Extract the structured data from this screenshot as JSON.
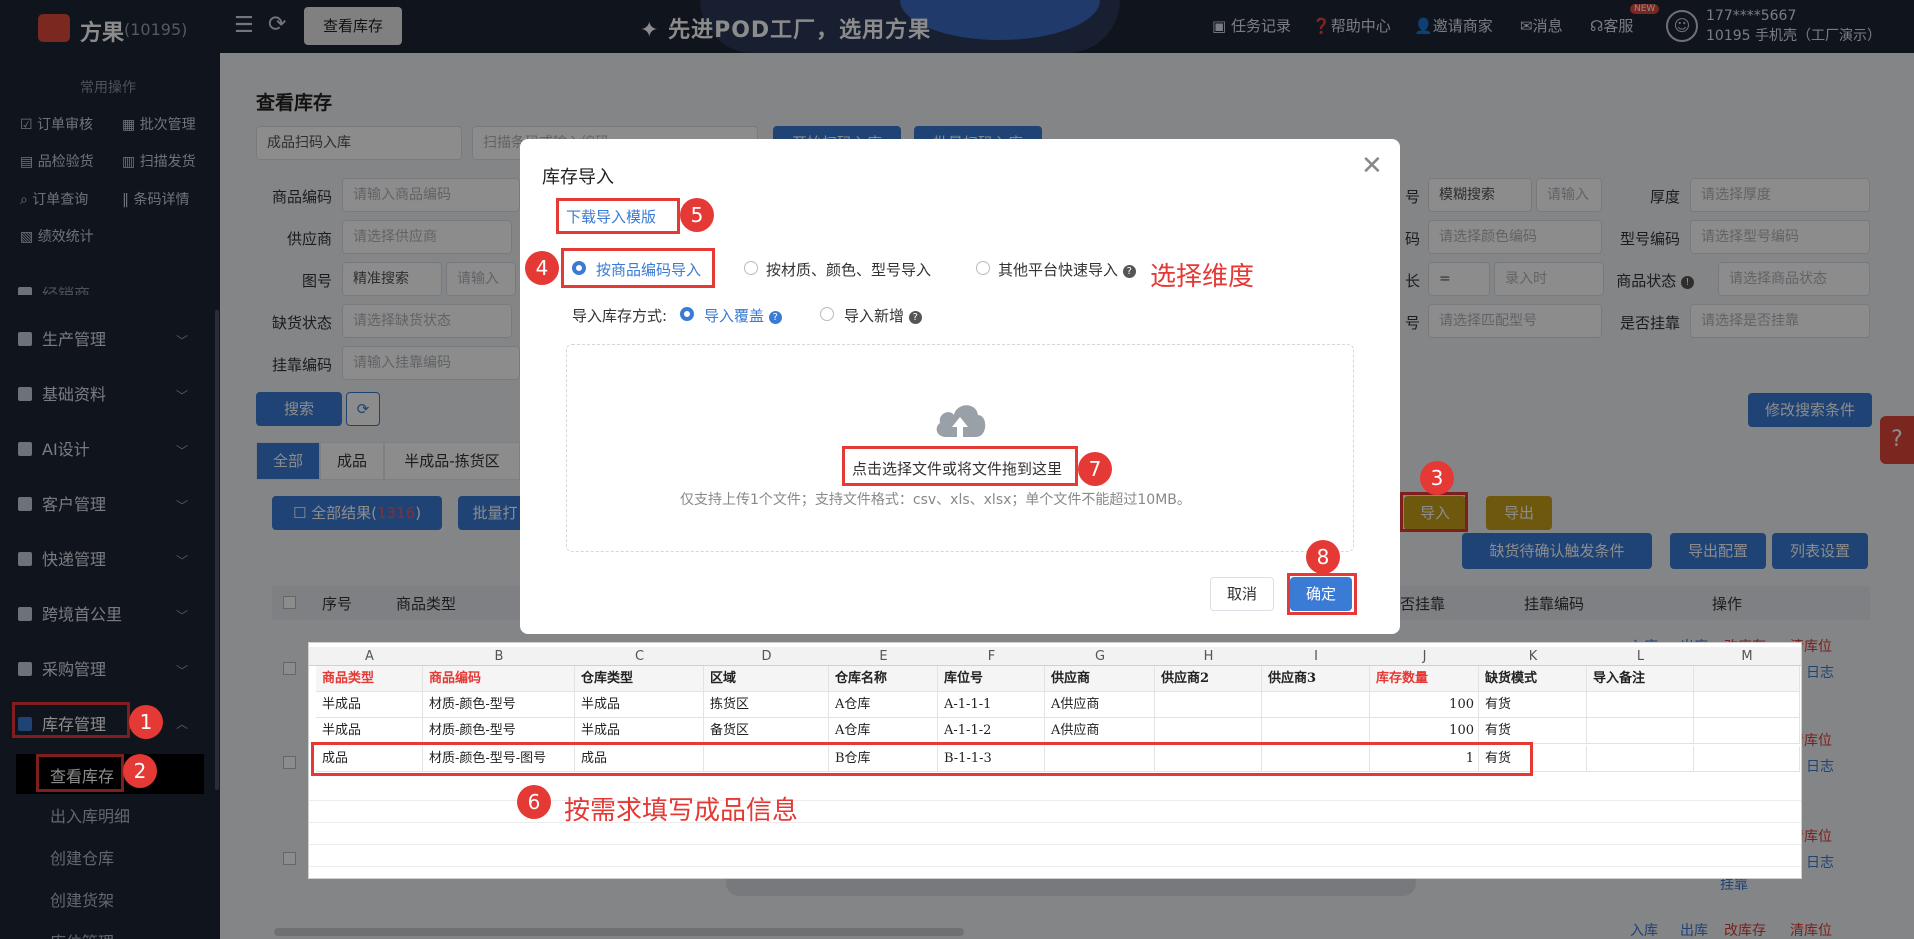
{
  "header": {
    "logo_name": "方果",
    "logo_id": "(10195)",
    "menu_icon": "hamburger-icon",
    "refresh_icon": "refresh-icon",
    "active_tab": "查看库存",
    "slogan": "✦ 先进POD工厂，选用方果",
    "links": [
      "任务记录",
      "帮助中心",
      "邀请商家",
      "消息",
      "客服"
    ],
    "new_badge": "NEW",
    "user_phone": "177****5667",
    "user_company": "10195 手机壳（工厂演示）"
  },
  "sidebar": {
    "common_title": "常用操作",
    "quick": [
      "订单审核",
      "批次管理",
      "品检验货",
      "扫描发货",
      "订单查询",
      "条码详情",
      "绩效统计"
    ],
    "partial_item": "经销商",
    "menus": [
      "生产管理",
      "基础资料",
      "AI设计",
      "客户管理",
      "快递管理",
      "跨境首公里",
      "采购管理",
      "库存管理"
    ],
    "sub_items": [
      "查看库存",
      "出入库明细",
      "创建仓库",
      "创建货架",
      "库位管理"
    ]
  },
  "page": {
    "title": "查看库存",
    "scan_select": "成品扫码入库",
    "scan_input": "扫描条码或输入编码",
    "btn_top1": "开始扫码入库",
    "btn_top2": "批量扫码入库",
    "filters": {
      "product_code_label": "商品编码",
      "product_code_ph": "请输入商品编码",
      "supplier_label": "供应商",
      "supplier_ph": "请选择供应商",
      "figure_label": "图号",
      "figure_mode": "精准搜索",
      "figure_ph": "请输入",
      "shortage_label": "缺货状态",
      "shortage_ph": "请选择缺货状态",
      "hang_code_label": "挂靠编码",
      "hang_code_ph": "请输入挂靠编码",
      "model_no_label": "号",
      "fuzzy": "模糊搜索",
      "fuzzy_ph": "请输入",
      "thickness_label": "厚度",
      "thickness_ph": "请选择厚度",
      "color_code_label": "码",
      "color_code_ph": "请选择颜色编码",
      "model_code_label": "型号编码",
      "model_code_ph": "请选择型号编码",
      "length_label": "长",
      "eq": "=",
      "len_ph": "录入时",
      "status_label": "商品状态",
      "status_ph": "请选择商品状态",
      "match_label": "号",
      "match_ph": "请选择匹配型号",
      "hang_label": "是否挂靠",
      "hang_ph": "请选择是否挂靠"
    },
    "search_btn": "搜索",
    "modify_search": "修改搜索条件",
    "tabs": [
      "全部",
      "成品",
      "半成品-拣货区",
      "半"
    ],
    "all_results": "全部结果(",
    "all_results_count": "1316",
    "all_results_end": ")",
    "batch_btn": "批量打",
    "import_btn": "导入",
    "export_btn": "导出",
    "shortage_trigger": "缺货待确认触发条件",
    "export_config": "导出配置",
    "list_settings": "列表设置",
    "table_headers": [
      "序号",
      "商品类型",
      "否挂靠",
      "挂靠编码",
      "操作"
    ],
    "row_actions": [
      "入库",
      "出库",
      "改库存",
      "清库位",
      "日志"
    ],
    "extra_link": "挂靠",
    "help_icon": "question-icon"
  },
  "modal": {
    "title": "库存导入",
    "download": "下载导入模版",
    "dims": [
      "按商品编码导入",
      "按材质、颜色、型号导入",
      "其他平台快速导入"
    ],
    "dim_note": "选择维度",
    "import_mode_label": "导入库存方式:",
    "modes": [
      "导入覆盖",
      "导入新增"
    ],
    "upload_text": "点击选择文件或将文件拖到这里",
    "upload_hint": "仅支持上传1个文件；支持文件格式：csv、xls、xlsx；单个文件不能超过10MB。",
    "cancel": "取消",
    "ok": "确定"
  },
  "badges": [
    "1",
    "2",
    "3",
    "4",
    "5",
    "6",
    "7",
    "8"
  ],
  "excel": {
    "columns": [
      "A",
      "B",
      "C",
      "D",
      "E",
      "F",
      "G",
      "H",
      "I",
      "J",
      "K",
      "L",
      "M"
    ],
    "headers": [
      "商品类型",
      "商品编码",
      "仓库类型",
      "区域",
      "仓库名称",
      "库位号",
      "供应商",
      "供应商2",
      "供应商3",
      "库存数量",
      "缺货模式",
      "导入备注",
      ""
    ],
    "rows": [
      [
        "半成品",
        "材质-颜色-型号",
        "半成品",
        "拣货区",
        "A仓库",
        "A-1-1-1",
        "A供应商",
        "",
        "",
        "100",
        "有货",
        "",
        ""
      ],
      [
        "半成品",
        "材质-颜色-型号",
        "半成品",
        "备货区",
        "A仓库",
        "A-1-1-2",
        "A供应商",
        "",
        "",
        "100",
        "有货",
        "",
        ""
      ],
      [
        "成品",
        "材质-颜色-型号-图号",
        "成品",
        "",
        "B仓库",
        "B-1-1-3",
        "",
        "",
        "",
        "1",
        "有货",
        "",
        ""
      ]
    ],
    "fill_note": "按需求填写成品信息"
  },
  "colors": {
    "accent": "#3a7bd5",
    "annotation": "#e53935",
    "gold": "#c7a018",
    "dark": "#1e2633"
  }
}
